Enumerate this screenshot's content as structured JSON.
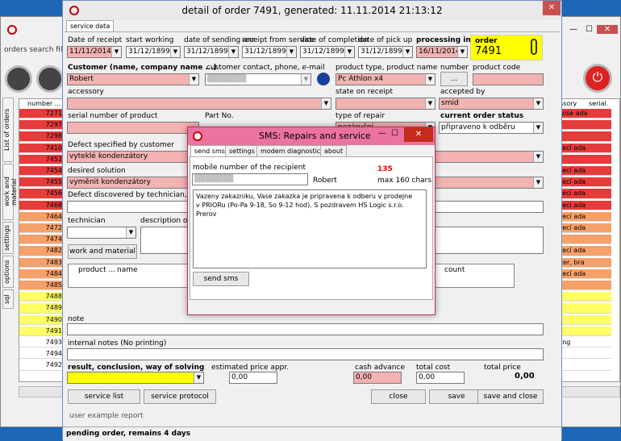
{
  "back": {
    "title_left": "orders  search  fil",
    "tabs": {
      "orders": "List of orders",
      "work": "work and material",
      "settings": "settings",
      "options": "options",
      "sql": "sql"
    },
    "col_number": "number ...",
    "col_accessory": "ssory",
    "col_serial": "serial.",
    "rows": [
      {
        "n": "7271",
        "c": "#e53b3b",
        "r": "vise ada"
      },
      {
        "n": "7297",
        "c": "#e53b3b",
        "r": ""
      },
      {
        "n": "7298",
        "c": "#e53b3b",
        "r": ""
      },
      {
        "n": "7410",
        "c": "#e53b3b",
        "r": "jecí ada"
      },
      {
        "n": "7452",
        "c": "#e53b3b",
        "r": ""
      },
      {
        "n": "7454",
        "c": "#e53b3b",
        "r": "jecí ada"
      },
      {
        "n": "7455",
        "c": "#e53b3b",
        "r": "jecí ada"
      },
      {
        "n": "7456",
        "c": "#e53b3b",
        "r": "jecí ada"
      },
      {
        "n": "7468",
        "c": "#e53b3b",
        "r": "jecí ada"
      },
      {
        "n": "7464",
        "c": "#f6a16a",
        "r": "jecí ada"
      },
      {
        "n": "7472",
        "c": "#f6a16a",
        "r": "jecí ada"
      },
      {
        "n": "7474",
        "c": "#f6a16a",
        "r": ""
      },
      {
        "n": "7482",
        "c": "#f6a16a",
        "r": "jecí ada"
      },
      {
        "n": "7483",
        "c": "#f6a16a",
        "r": "ter, bra"
      },
      {
        "n": "7484",
        "c": "#f6a16a",
        "r": "jecí ada"
      },
      {
        "n": "7485",
        "c": "#f6a16a",
        "r": ""
      },
      {
        "n": "7488",
        "c": "#ffff66",
        "r": ""
      },
      {
        "n": "7489",
        "c": "#ffff66",
        "r": ""
      },
      {
        "n": "7490",
        "c": "#ffff66",
        "r": ""
      },
      {
        "n": "7491",
        "c": "#ffff66",
        "r": ""
      },
      {
        "n": "7493",
        "c": "#ffffff",
        "r": "ing"
      },
      {
        "n": "7494",
        "c": "#ffffff",
        "r": ""
      },
      {
        "n": "7492",
        "c": "#ffffff",
        "r": ""
      }
    ]
  },
  "detail": {
    "title": "detail of order 7491, generated: 11.11.2014 21:13:12",
    "tab": "service data",
    "date_receipt_label": "Date of receipt",
    "start_working_label": "start working",
    "date_sending_label": "date of sending anr",
    "receipt_service_label": "receipt from service",
    "date_completion_label": "date of completion",
    "date_pickup_label": "date of pick up",
    "processing_label": "processing in",
    "order_label": "order",
    "order_no": "7491",
    "date_receipt": "11/11/2014",
    "start_working": "31/12/1899",
    "date_sending": "31/12/1899",
    "receipt_service": "31/12/1899",
    "date_completion": "31/12/1899",
    "date_pickup": "31/12/1899",
    "processing": "16/11/2014",
    "customer_label": "Customer (name, company name ...)",
    "customer": "Robert",
    "contact_label": "customer contact, phone, e-mail",
    "product_type_label": "product type, product name",
    "product_type": "Pc Athlon x4",
    "number_label": "number",
    "number_btn": "...",
    "product_code_label": "product code",
    "accessory_label": "accessory",
    "state_receipt_label": "state on receipt",
    "accepted_label": "accepted by",
    "accepted": "smid",
    "serial_label": "serial number of product",
    "part_label": "Part No.",
    "type_repair_label": "type of repair",
    "type_repair": "nezáruční",
    "status_label": "current order status",
    "status": "připraveno k odběru",
    "defect_label": "Defect specified by customer",
    "defect": "vyteklé kondenzátory",
    "solution_label": "desired solution",
    "solution": "vyměnit kondenzátory",
    "defect_tech_label": "Defect discovered by technician, verifie",
    "technician_label": "technician",
    "description_label": "description of w",
    "work_btn": "work and material",
    "col_product": "product ...",
    "col_name": "name",
    "col_count": "count",
    "note_label": "note",
    "internal_label": "internal notes (No printing)",
    "result_label": "result, conclusion, way of solving",
    "est_price_label": "estimated price appr.",
    "est_price": "0,00",
    "cash_label": "cash advance",
    "cash": "0,00",
    "total_cost_label": "total cost",
    "total_cost": "0,00",
    "total_price_label": "total price",
    "total_price": "0,00",
    "service_list_btn": "service list",
    "service_protocol_btn": "service protocol",
    "close_btn": "close",
    "save_btn": "save",
    "save_close_btn": "save and close",
    "user_report": "user example report",
    "status_bar": "pending order, remains 4 days"
  },
  "sms": {
    "title": "SMS: Repairs and service",
    "tabs": [
      "send sms",
      "settings",
      "modem diagnostics",
      "about"
    ],
    "mobile_label": "mobile number of the recipient",
    "name": "Robert",
    "count": "135",
    "max": "max 160 chars",
    "message": "Vazeny zakazniku, Vase zakazka je pripravena k odberu v prodejne v PRIORu (Po-Pa 9-18, So 9-12 hod). S pozdravem HS Logic s.r.o. Prerov",
    "send_btn": "send sms"
  }
}
